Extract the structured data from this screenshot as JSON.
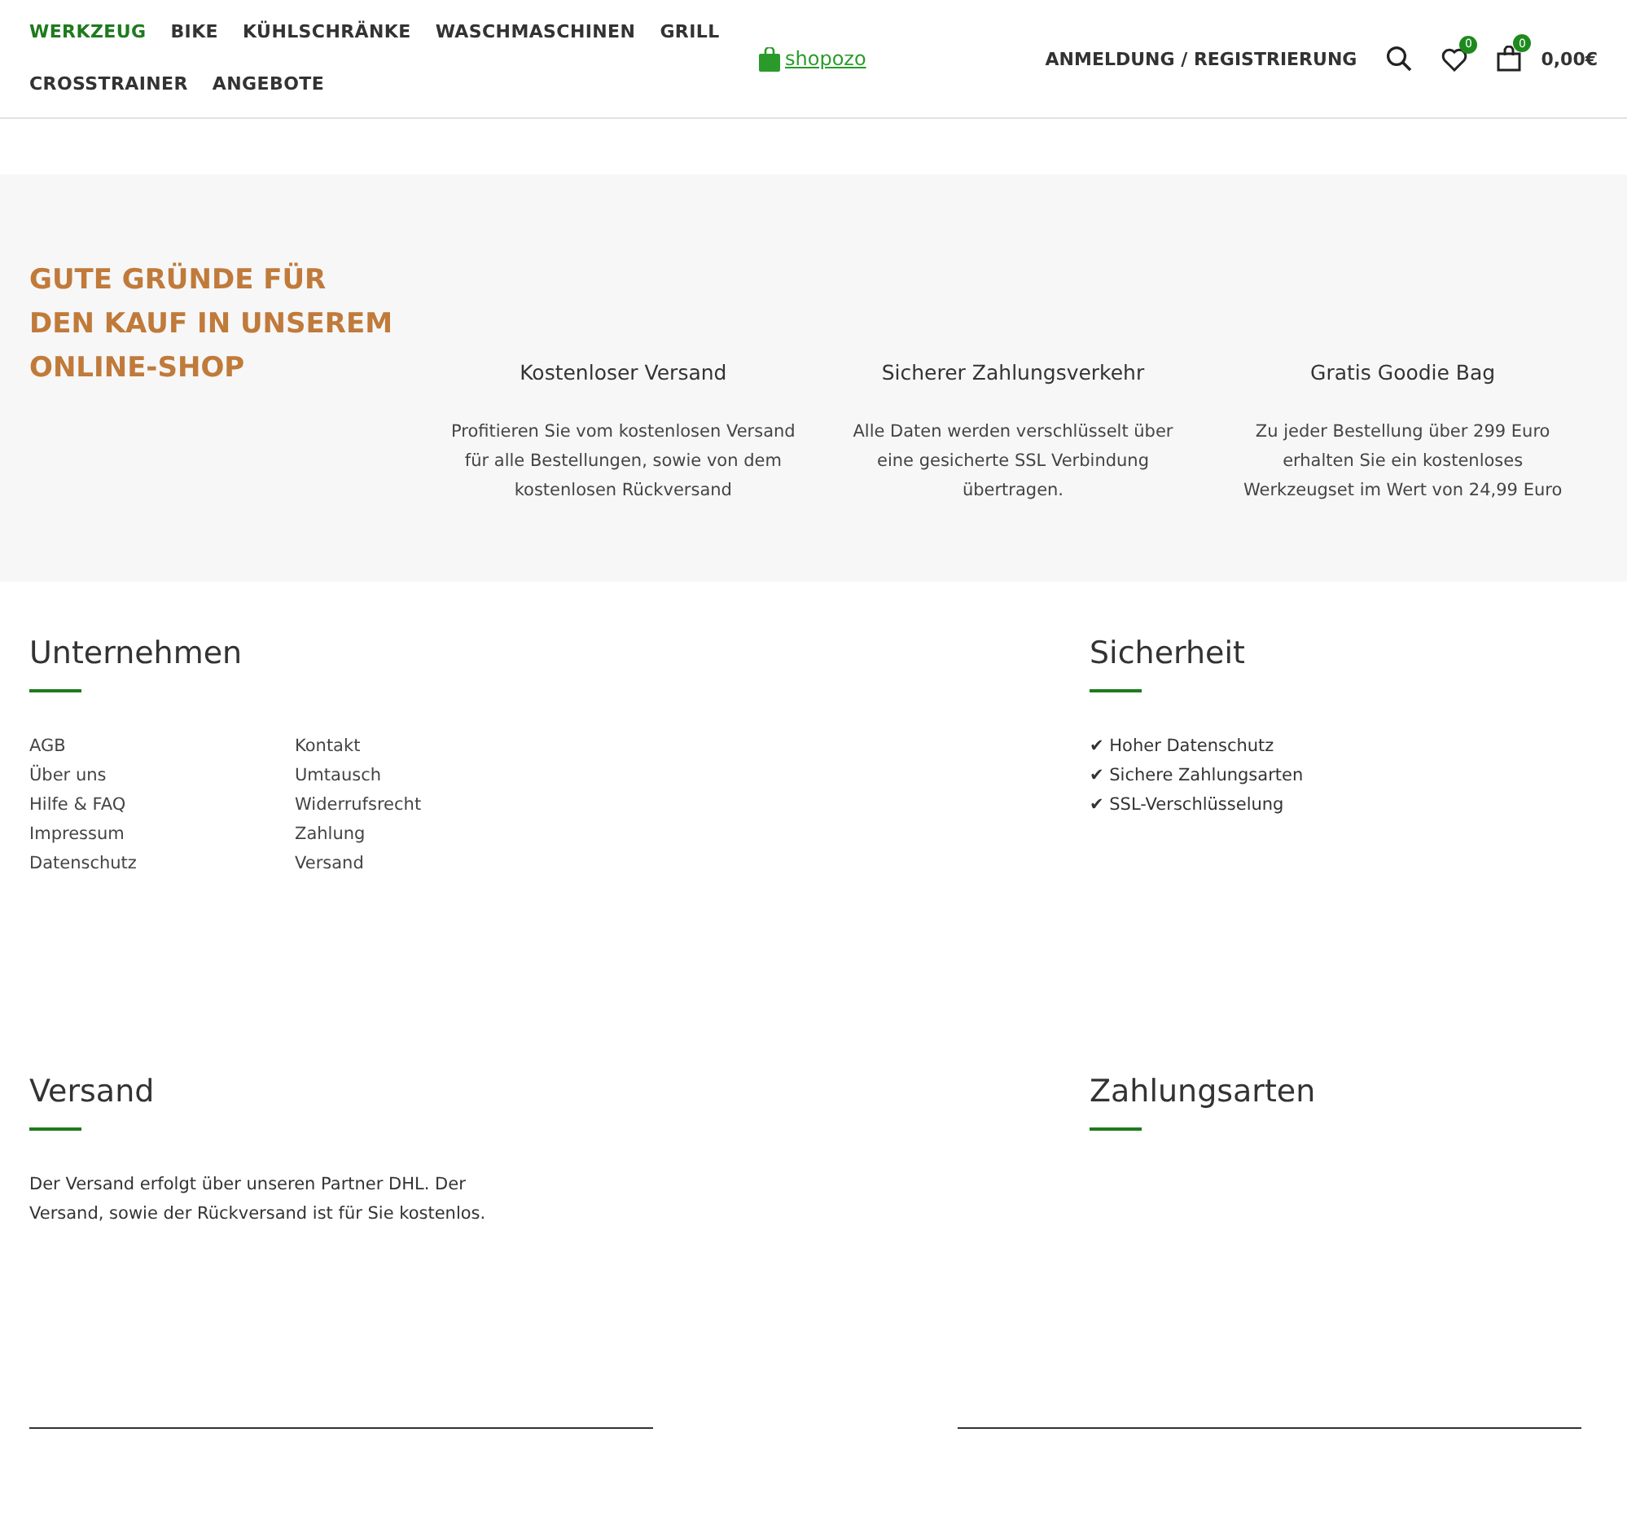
{
  "nav": [
    {
      "label": "WERKZEUG",
      "selected": true
    },
    {
      "label": "BIKE",
      "selected": false
    },
    {
      "label": "KÜHLSCHRÄNKE",
      "selected": false
    },
    {
      "label": "WASCHMASCHINEN",
      "selected": false
    },
    {
      "label": "GRILL",
      "selected": false
    },
    {
      "label": "CROSSTRAINER",
      "selected": false
    },
    {
      "label": "ANGEBOTE",
      "selected": false
    }
  ],
  "logo": "shopozo",
  "account": {
    "login": "ANMELDUNG / REGISTRIERUNG",
    "wishlist_count": "0",
    "cart_count": "0",
    "cart_total": "0,00€"
  },
  "reasons": {
    "title": [
      "GUTE GRÜNDE FÜR",
      "DEN KAUF IN UNSEREM",
      "ONLINE-SHOP"
    ],
    "items": [
      {
        "heading": "Kostenloser Versand",
        "text": [
          "Profitieren Sie vom kostenlosen Versand",
          "für alle Bestellungen, sowie von dem",
          "kostenlosen Rückversand"
        ]
      },
      {
        "heading": "Sicherer Zahlungsverkehr",
        "text": [
          "Alle Daten werden verschlüsselt über",
          "eine gesicherte SSL Verbindung",
          "übertragen."
        ]
      },
      {
        "heading": "Gratis Goodie Bag",
        "text": [
          "Zu jeder Bestellung über 299 Euro",
          "erhalten Sie ein kostenloses",
          "Werkzeugset im Wert von 24,99 Euro"
        ]
      }
    ]
  },
  "footer": [
    {
      "heading": "Unternehmen",
      "kind": "links",
      "columns": [
        [
          "AGB",
          "Über uns",
          "Hilfe & FAQ",
          "Impressum",
          "Datenschutz"
        ],
        [
          "Kontakt",
          "Umtausch",
          "Widerrufsrecht",
          "Zahlung",
          "Versand"
        ]
      ]
    },
    {
      "heading": "Sicherheit",
      "kind": "checklist",
      "items": [
        {
          "mark": "✔",
          "label": "Hoher Datenschutz"
        },
        {
          "mark": "✔",
          "label": "Sichere Zahlungsarten"
        },
        {
          "mark": "✔",
          "label": "SSL-Verschlüsselung"
        }
      ]
    },
    {
      "heading": "Versand",
      "kind": "text",
      "lines": [
        "Der Versand erfolgt über unseren Partner DHL. Der",
        "Versand, sowie der Rückversand ist für Sie kostenlos."
      ]
    },
    {
      "heading": "Zahlungsarten",
      "kind": "empty"
    }
  ]
}
